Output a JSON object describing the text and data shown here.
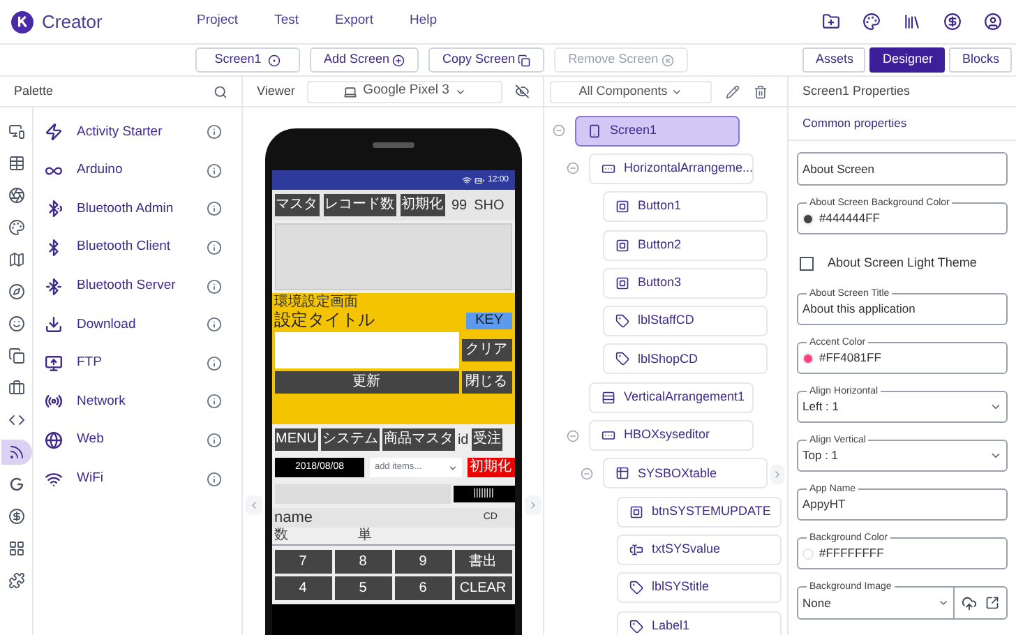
{
  "app": {
    "name": "Creator"
  },
  "menu": [
    "Project",
    "Test",
    "Export",
    "Help"
  ],
  "header_icons": [
    {
      "kind": "folder"
    },
    {
      "kind": "palette"
    },
    {
      "kind": "library"
    },
    {
      "kind": "dollar"
    },
    {
      "kind": "user"
    }
  ],
  "toolbar": {
    "screen_button": "Screen1",
    "actions": [
      {
        "label": "Add Screen",
        "kind": "add",
        "disabled": false
      },
      {
        "label": "Copy Screen",
        "kind": "copy",
        "disabled": false
      },
      {
        "label": "Remove Screen",
        "kind": "remove",
        "disabled": true
      }
    ],
    "views": [
      {
        "label": "Assets",
        "selected": false
      },
      {
        "label": "Designer",
        "selected": true
      },
      {
        "label": "Blocks",
        "selected": false
      }
    ]
  },
  "palette": {
    "title": "Palette",
    "categories": [
      {
        "kind": "devices",
        "selected": false
      },
      {
        "kind": "table",
        "selected": false
      },
      {
        "kind": "aperture",
        "selected": false
      },
      {
        "kind": "palette",
        "selected": false
      },
      {
        "kind": "map",
        "selected": false
      },
      {
        "kind": "compass",
        "selected": false
      },
      {
        "kind": "smile",
        "selected": false
      },
      {
        "kind": "copy",
        "selected": false
      },
      {
        "kind": "briefcase",
        "selected": false
      },
      {
        "kind": "code",
        "selected": false
      },
      {
        "kind": "rss",
        "selected": true
      },
      {
        "kind": "g",
        "selected": false
      },
      {
        "kind": "dollar",
        "selected": false
      },
      {
        "kind": "grid",
        "selected": false
      },
      {
        "kind": "puzzle",
        "selected": false
      }
    ],
    "items": [
      {
        "label": "Activity Starter",
        "kind": "bolt"
      },
      {
        "label": "Arduino",
        "kind": "infinity"
      },
      {
        "label": "Bluetooth Admin",
        "kind": "bluetooth-search"
      },
      {
        "label": "Bluetooth Client",
        "kind": "bluetooth"
      },
      {
        "label": "Bluetooth Server",
        "kind": "bluetooth-connected"
      },
      {
        "label": "Download",
        "kind": "download"
      },
      {
        "label": "FTP",
        "kind": "monitor"
      },
      {
        "label": "Network",
        "kind": "radio"
      },
      {
        "label": "Web",
        "kind": "globe"
      },
      {
        "label": "WiFi",
        "kind": "wifi"
      }
    ]
  },
  "viewer": {
    "title": "Viewer",
    "device": "Google Pixel 3"
  },
  "phone": {
    "status_time": "12:00",
    "top_buttons": [
      "マスタ",
      "レコード数",
      "初期化"
    ],
    "staff_cd": "99",
    "shop_cd": "SHO",
    "settings": {
      "caption": "環境設定画面",
      "title": "設定タイトル",
      "key": "KEY",
      "clear_button": "クリア",
      "update_button": "更新",
      "close_button": "閉じる"
    },
    "menu_buttons": [
      "MENU",
      "システム",
      "商品マスタ"
    ],
    "id_label": "id",
    "order_button": "受注",
    "date": "2018/08/08",
    "items_dropdown": {
      "placeholder": "add items..."
    },
    "reset_button": "初期化",
    "barcode": "||||||||",
    "name_label": "name",
    "cd_label": "CD",
    "qty_label": "数",
    "unit_label": "単",
    "keypad": [
      "7",
      "8",
      "9",
      "書出",
      "4",
      "5",
      "6",
      "CLEAR"
    ]
  },
  "components": {
    "filter": "All Components",
    "tree": [
      {
        "name": "Screen1",
        "kind": "screen",
        "selected": true,
        "expanded": true,
        "children": [
          {
            "name": "HorizontalArrangeme...",
            "kind": "horizontal",
            "selected": false,
            "expanded": true,
            "children": [
              {
                "name": "Button1",
                "kind": "button",
                "selected": false
              },
              {
                "name": "Button2",
                "kind": "button",
                "selected": false
              },
              {
                "name": "Button3",
                "kind": "button",
                "selected": false
              },
              {
                "name": "lblStaffCD",
                "kind": "label",
                "selected": false
              },
              {
                "name": "lblShopCD",
                "kind": "label",
                "selected": false
              }
            ]
          },
          {
            "name": "VerticalArrangement1",
            "kind": "vertical",
            "selected": false
          },
          {
            "name": "HBOXsyseditor",
            "kind": "horizontal",
            "selected": false,
            "expanded": true,
            "children": [
              {
                "name": "SYSBOXtable",
                "kind": "table",
                "selected": false,
                "expanded": true,
                "children": [
                  {
                    "name": "btnSYSTEMUPDATE",
                    "kind": "button",
                    "selected": false
                  },
                  {
                    "name": "txtSYSvalue",
                    "kind": "textbox",
                    "selected": false
                  },
                  {
                    "name": "lblSYStitle",
                    "kind": "label",
                    "selected": false
                  },
                  {
                    "name": "Label1",
                    "kind": "label",
                    "selected": false
                  }
                ]
              }
            ]
          }
        ]
      }
    ]
  },
  "properties": {
    "title": "Screen1 Properties",
    "tab": "Common properties",
    "fields": [
      {
        "kind": "textarea",
        "value": "About Screen"
      },
      {
        "kind": "color",
        "label": "About Screen Background Color",
        "value": "#444444FF",
        "color": "#444444"
      },
      {
        "kind": "checkbox",
        "label": "About Screen Light Theme",
        "checked": false
      },
      {
        "kind": "text",
        "label": "About Screen Title",
        "value": "About this application"
      },
      {
        "kind": "color",
        "label": "Accent Color",
        "value": "#FF4081FF",
        "color": "#ff4081"
      },
      {
        "kind": "select",
        "label": "Align Horizontal",
        "value": "Left : 1"
      },
      {
        "kind": "select",
        "label": "Align Vertical",
        "value": "Top : 1"
      },
      {
        "kind": "text",
        "label": "App Name",
        "value": "AppyHT"
      },
      {
        "kind": "color",
        "label": "Background Color",
        "value": "#FFFFFFFF",
        "color": "#ffffff"
      },
      {
        "kind": "image",
        "label": "Background Image",
        "value": "None"
      }
    ]
  }
}
